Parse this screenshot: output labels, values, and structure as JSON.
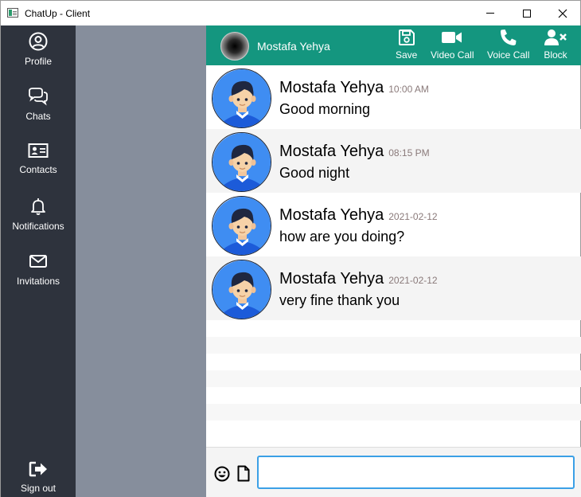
{
  "window": {
    "title": "ChatUp - Client",
    "controls": {
      "minimize": "minimize",
      "maximize": "maximize",
      "close": "close"
    }
  },
  "sidebar": {
    "items": [
      {
        "label": "Profile",
        "icon": "user-circle-icon"
      },
      {
        "label": "Chats",
        "icon": "chat-bubbles-icon"
      },
      {
        "label": "Contacts",
        "icon": "id-card-icon"
      },
      {
        "label": "Notifications",
        "icon": "bell-icon"
      },
      {
        "label": "Invitations",
        "icon": "envelope-icon"
      }
    ],
    "signout": {
      "label": "Sign out",
      "icon": "sign-out-icon"
    }
  },
  "chat_header": {
    "contact_name": "Mostafa Yehya",
    "actions": [
      {
        "label": "Save",
        "icon": "save-icon"
      },
      {
        "label": "Video Call",
        "icon": "video-camera-icon"
      },
      {
        "label": "Voice Call",
        "icon": "phone-icon"
      },
      {
        "label": "Block",
        "icon": "user-block-icon"
      }
    ]
  },
  "messages": [
    {
      "author": "Mostafa Yehya",
      "time": "10:00 AM",
      "text": "Good morning"
    },
    {
      "author": "Mostafa Yehya",
      "time": "08:15 PM",
      "text": "Good night"
    },
    {
      "author": "Mostafa Yehya",
      "time": "2021-02-12",
      "text": "how are you doing?"
    },
    {
      "author": "Mostafa Yehya",
      "time": "2021-02-12",
      "text": "very fine thank you"
    }
  ],
  "composer": {
    "value": "",
    "placeholder": "",
    "emoji_icon": "smiley-icon",
    "file_icon": "document-icon"
  },
  "colors": {
    "sidebar": "#2e333d",
    "contacts_panel": "#868e9c",
    "header": "#14967f",
    "input_focus": "#3ba0e6",
    "timestamp": "#8a7a7a"
  }
}
